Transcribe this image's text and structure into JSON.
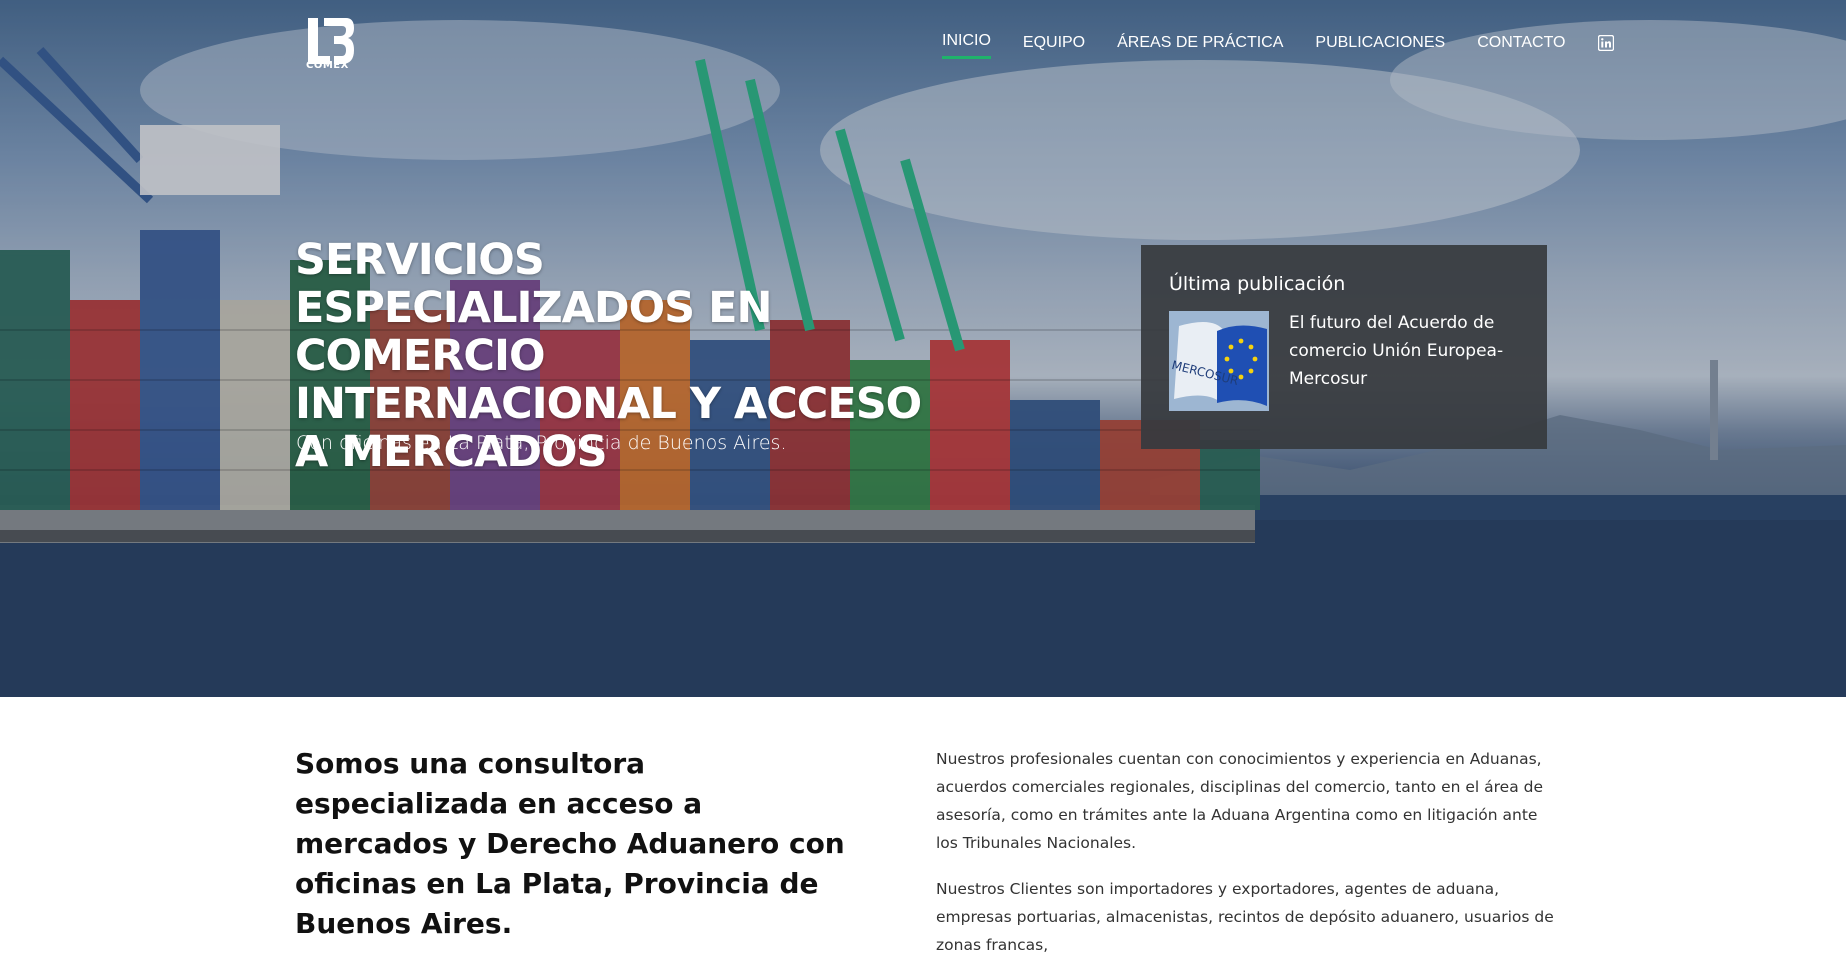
{
  "brand": {
    "logo_text": "COMEX"
  },
  "nav": {
    "items": [
      {
        "label": "INICIO",
        "active": true
      },
      {
        "label": "EQUIPO",
        "active": false
      },
      {
        "label": "ÁREAS DE PRÁCTICA",
        "active": false
      },
      {
        "label": "PUBLICACIONES",
        "active": false
      },
      {
        "label": "CONTACTO",
        "active": false
      }
    ],
    "social_icon": "linkedin-icon",
    "active_color": "#1fb36b"
  },
  "hero": {
    "title": "SERVICIOS ESPECIALIZADOS EN COMERCIO INTERNACIONAL Y ACCESO A MERCADOS",
    "subtitle": "Con oficinas en La Plata, Provincia de Buenos Aires."
  },
  "latest_publication": {
    "heading": "Última publicación",
    "title": "El futuro del Acuerdo de comercio Unión Europea-Mercosur",
    "thumbnail_text": "MERCOSUR"
  },
  "intro": {
    "heading": "Somos una consultora especializada en acceso a mercados y Derecho Aduanero con oficinas en La Plata, Provincia de Buenos Aires.",
    "paragraphs": [
      "Nuestros profesionales cuentan con conocimientos y experiencia en Aduanas, acuerdos comerciales regionales, disciplinas del comercio, tanto en el área de asesoría, como en trámites ante la Aduana Argentina como en litigación ante los Tribunales Nacionales.",
      "Nuestros Clientes son importadores y exportadores, agentes de aduana, empresas portuarias, almacenistas, recintos de depósito aduanero, usuarios de zonas francas,"
    ]
  }
}
